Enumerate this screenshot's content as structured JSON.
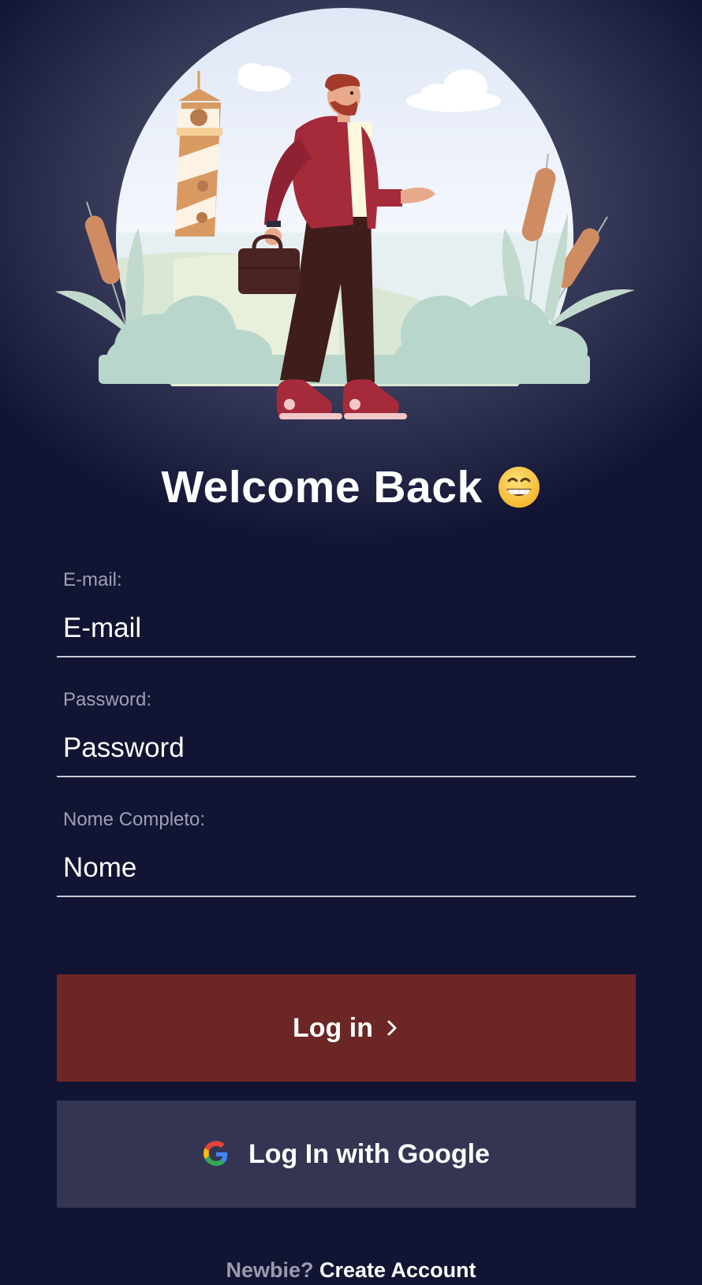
{
  "header": {
    "title": "Welcome Back",
    "title_emoji": "grinning-face-icon"
  },
  "illustration": {
    "name": "man-with-briefcase-lighthouse-illustration"
  },
  "form": {
    "email": {
      "label": "E-mail:",
      "placeholder": "E-mail",
      "value": ""
    },
    "password": {
      "label": "Password:",
      "placeholder": "Password",
      "value": ""
    },
    "name": {
      "label": "Nome Completo:",
      "placeholder": "Nome",
      "value": ""
    }
  },
  "buttons": {
    "login_label": "Log in",
    "google_label": "Log In with Google"
  },
  "footer": {
    "prompt": "Newbie?",
    "link": "Create Account"
  },
  "colors": {
    "background": "#121433",
    "login_button": "#6c2626",
    "google_button": "#333552"
  }
}
